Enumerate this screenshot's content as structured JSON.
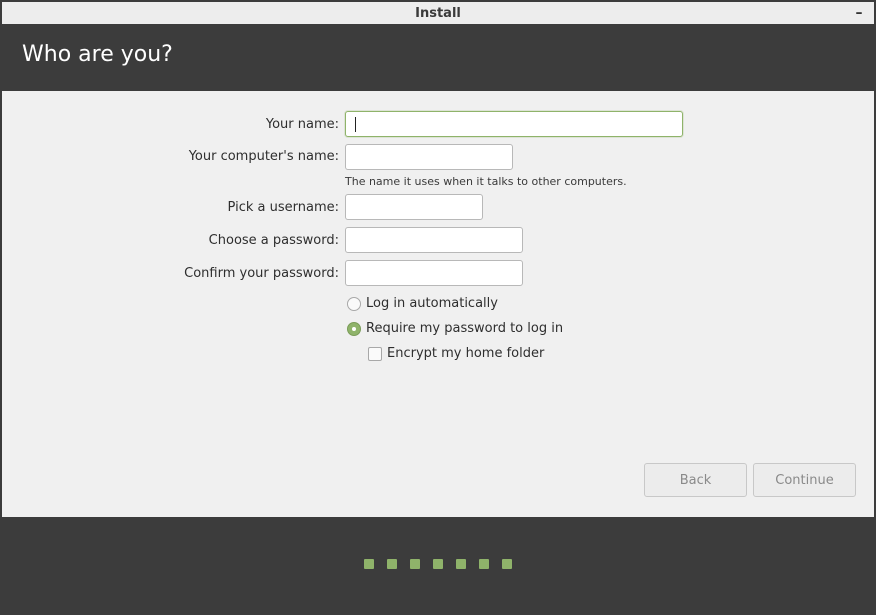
{
  "window": {
    "title": "Install",
    "minimize_glyph": "–"
  },
  "header": {
    "title": "Who are you?"
  },
  "form": {
    "your_name": {
      "label": "Your name:",
      "value": ""
    },
    "computer_name": {
      "label": "Your computer's name:",
      "value": "",
      "hint": "The name it uses when it talks to other computers."
    },
    "username": {
      "label": "Pick a username:",
      "value": ""
    },
    "password": {
      "label": "Choose a password:",
      "value": ""
    },
    "confirm_password": {
      "label": "Confirm your password:",
      "value": ""
    },
    "login_options": [
      {
        "label": "Log in automatically",
        "selected": false
      },
      {
        "label": "Require my password to log in",
        "selected": true
      }
    ],
    "encrypt_home": {
      "label": "Encrypt my home folder",
      "checked": false
    }
  },
  "buttons": {
    "back": "Back",
    "continue": "Continue"
  },
  "progress": {
    "steps_total": 7,
    "colors": {
      "accent": "#8fb36a",
      "header": "#3c3c3c",
      "content_bg": "#f0f0f0"
    }
  }
}
